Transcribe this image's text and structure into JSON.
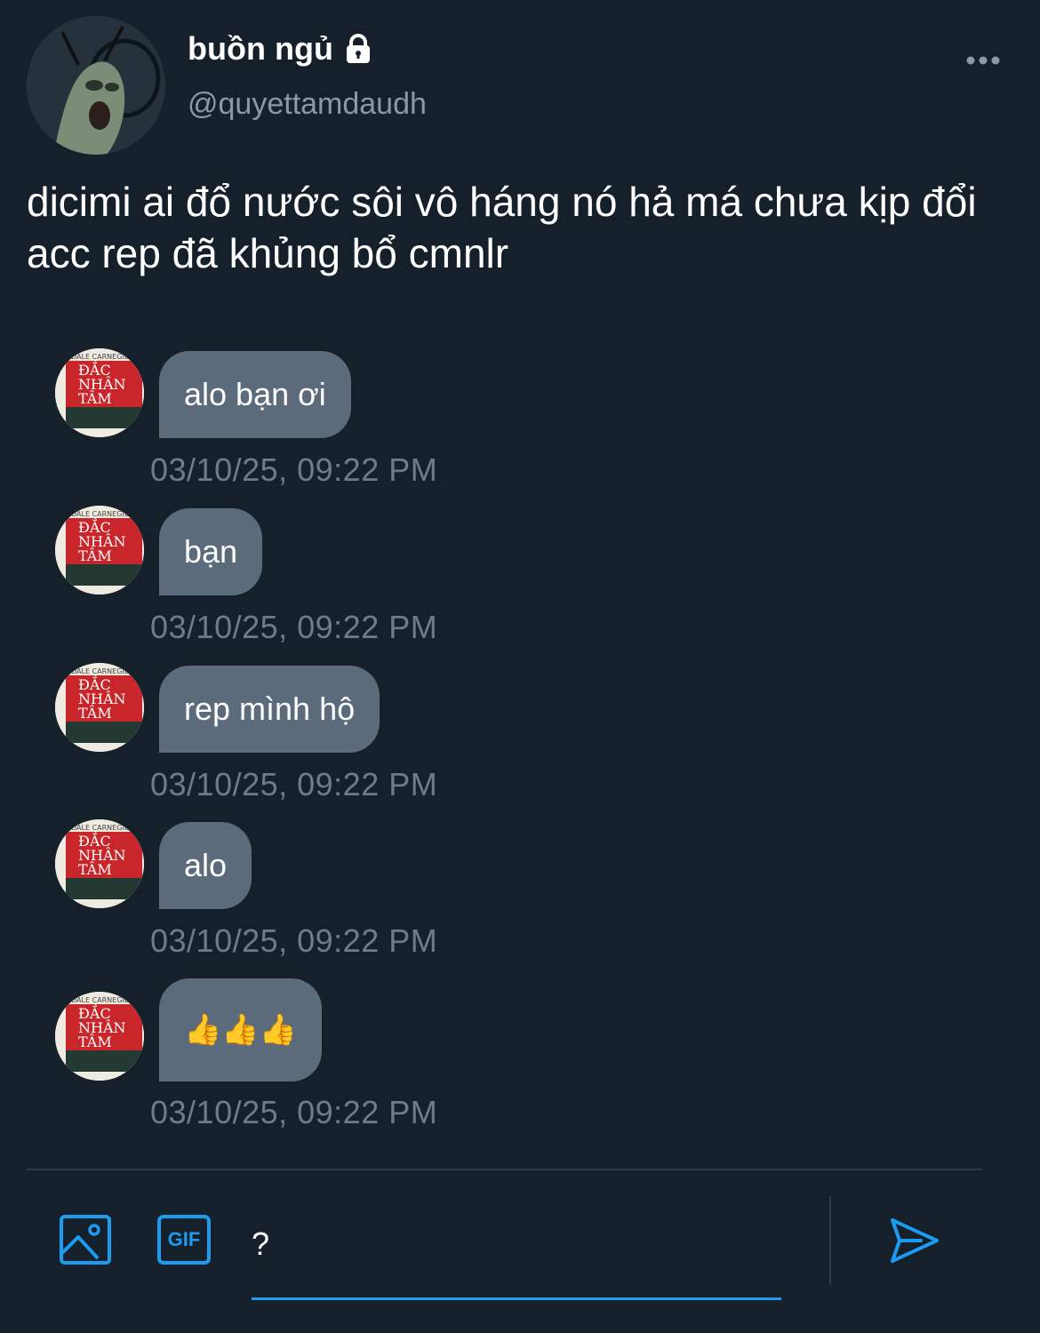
{
  "profile": {
    "display_name": "buồn ngủ",
    "handle": "@quyettamdaudh",
    "lock_icon": "lock-icon",
    "more_icon": "more-horizontal-icon"
  },
  "tweet": {
    "text": "dicimi ai đổ nước sôi vô háng nó hả má chưa kịp đổi acc rep đã khủng bổ cmnlr"
  },
  "messages": [
    {
      "text": "alo bạn ơi",
      "time": "03/10/25, 09:22 PM"
    },
    {
      "text": "bạn",
      "time": "03/10/25, 09:22 PM"
    },
    {
      "text": "rep mình hộ",
      "time": "03/10/25, 09:22 PM"
    },
    {
      "text": "alo",
      "time": "03/10/25, 09:22 PM"
    },
    {
      "text": "👍👍👍",
      "time": "03/10/25, 09:22 PM"
    }
  ],
  "compose": {
    "value": "?",
    "image_icon": "image-icon",
    "gif_label": "GIF",
    "send_icon": "send-icon"
  },
  "colors": {
    "background": "#15202b",
    "bubble": "#5b6b7b",
    "accent": "#1d9bf0",
    "secondary_text": "#8b98a5"
  }
}
